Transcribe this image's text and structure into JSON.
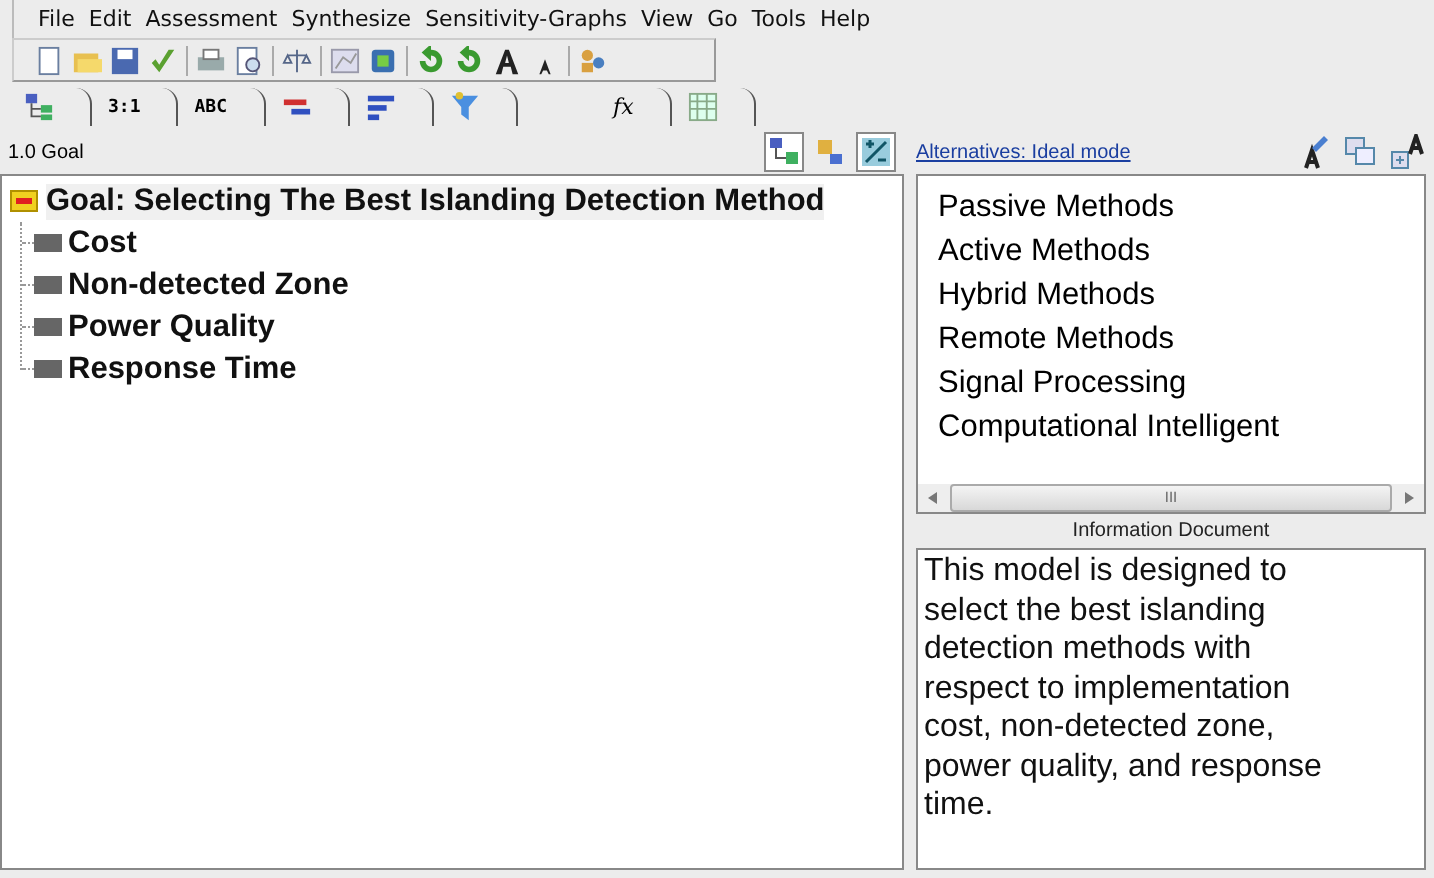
{
  "menu": [
    "File",
    "Edit",
    "Assessment",
    "Synthesize",
    "Sensitivity-Graphs",
    "View",
    "Go",
    "Tools",
    "Help"
  ],
  "tabs": [
    {
      "kind": "icon"
    },
    {
      "kind": "text",
      "label": "3:1"
    },
    {
      "kind": "text",
      "label": "ABC"
    },
    {
      "kind": "icon"
    },
    {
      "kind": "icon"
    },
    {
      "kind": "icon"
    },
    {
      "kind": "text",
      "label": "fx"
    },
    {
      "kind": "icon"
    }
  ],
  "tree_panel": {
    "title": "1.0 Goal",
    "root": {
      "label": "Goal: Selecting The Best Islanding Detection Method",
      "expanded": true,
      "children": [
        {
          "label": "Cost"
        },
        {
          "label": "Non-detected Zone"
        },
        {
          "label": "Power Quality"
        },
        {
          "label": "Response Time"
        }
      ]
    }
  },
  "alternatives": {
    "link": "Alternatives: Ideal mode",
    "items": [
      "Passive Methods",
      "Active Methods",
      "Hybrid Methods",
      "Remote Methods",
      "Signal Processing",
      "Computational Intelligent"
    ]
  },
  "scrollbar_grip": "III",
  "information": {
    "title": "Information Document",
    "text": "This model is designed to select the best islanding detection methods with respect to implementation cost, non-detected zone, power quality, and response time."
  }
}
